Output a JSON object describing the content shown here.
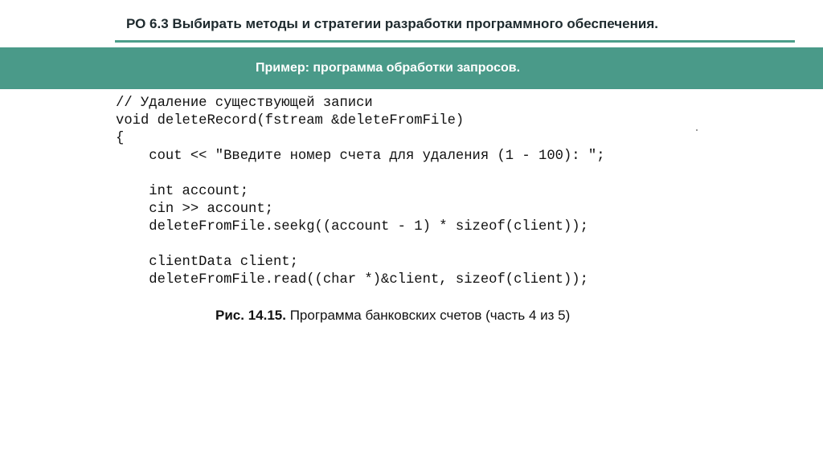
{
  "slide": {
    "title": "РО 6.3 Выбирать методы и стратегии разработки программного обеспечения.",
    "banner": "Пример: программа обработки запросов."
  },
  "code": {
    "lines": [
      "// Удаление существующей записи",
      "void deleteRecord(fstream &deleteFromFile)",
      "{",
      "    cout << \"Введите номер счета для удаления (1 - 100): \";",
      "",
      "    int account;",
      "    cin >> account;",
      "    deleteFromFile.seekg((account - 1) * sizeof(client));",
      "",
      "    clientData client;",
      "    deleteFromFile.read((char *)&client, sizeof(client));"
    ]
  },
  "caption": {
    "label": "Рис. 14.15.",
    "text": " Программа банковских счетов (часть 4 из 5)"
  },
  "colors": {
    "accent": "#4a9a89",
    "title_text": "#1e2a2e"
  }
}
